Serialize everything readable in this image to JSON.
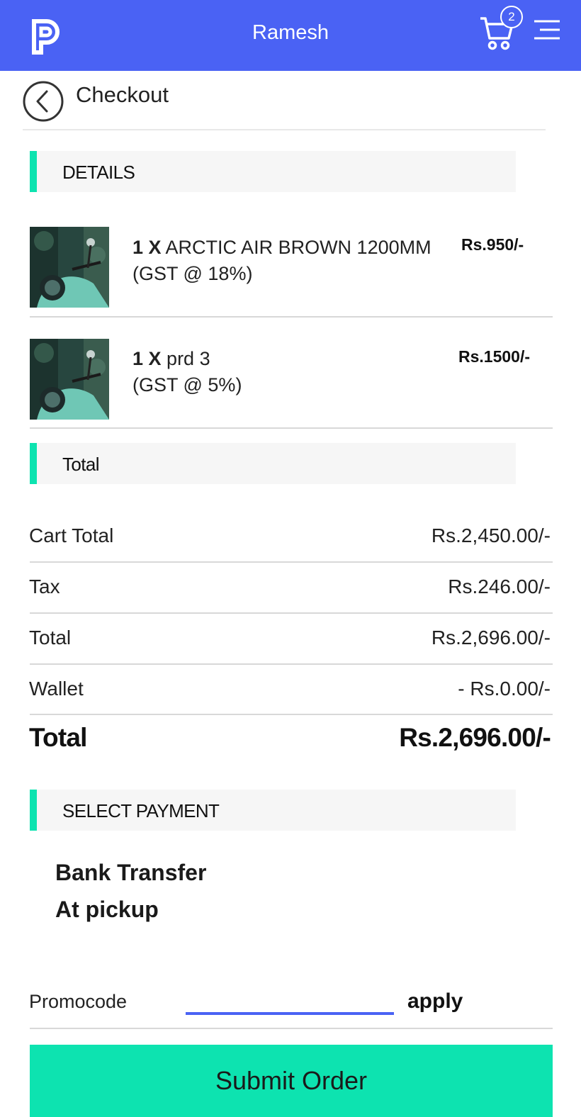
{
  "colors": {
    "brand": "#4a62f4",
    "accent": "#0de3b0"
  },
  "header": {
    "title": "Ramesh",
    "cart_count": "2",
    "logo_icon": "logo-icon",
    "cart_icon": "cart-icon",
    "menu_icon": "hamburger-menu-icon"
  },
  "page": {
    "title": "Checkout",
    "back_icon": "back-arrow-icon"
  },
  "details": {
    "heading": "DETAILS",
    "items": [
      {
        "qty": "1 X",
        "name": "ARCTIC AIR BROWN 1200MM",
        "tax": "(GST @ 18%)",
        "price": "Rs.950/-"
      },
      {
        "qty": "1 X",
        "name": "prd 3",
        "tax": "(GST @ 5%)",
        "price": "Rs.1500/-"
      }
    ]
  },
  "totals": {
    "heading": "Total",
    "rows": [
      {
        "label": "Cart Total",
        "value": "Rs.2,450.00/-"
      },
      {
        "label": "Tax",
        "value": "Rs.246.00/-"
      },
      {
        "label": "Total",
        "value": "Rs.2,696.00/-"
      },
      {
        "label": "Wallet",
        "value": "- Rs.0.00/-"
      }
    ],
    "grand": {
      "label": "Total",
      "value": "Rs.2,696.00/-"
    }
  },
  "payment": {
    "heading": "SELECT PAYMENT",
    "options": [
      "Bank Transfer",
      "At pickup"
    ]
  },
  "promo": {
    "label": "Promocode",
    "value": "",
    "apply": "apply"
  },
  "submit": {
    "label": "Submit Order"
  }
}
